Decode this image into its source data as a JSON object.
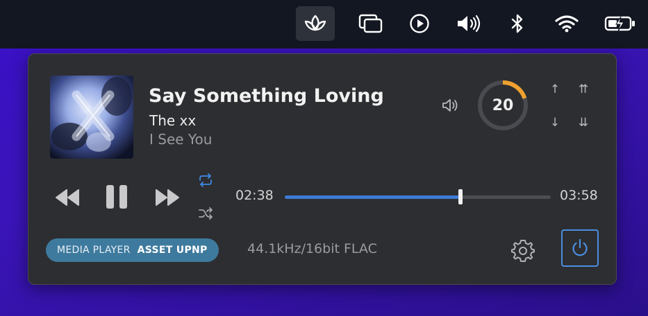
{
  "menubar": {
    "items": [
      {
        "icon": "lotus-icon",
        "active": true
      },
      {
        "icon": "windows-icon"
      },
      {
        "icon": "play-circle-icon"
      },
      {
        "icon": "speaker-icon"
      },
      {
        "icon": "bluetooth-icon"
      },
      {
        "icon": "wifi-icon"
      },
      {
        "icon": "battery-charging-icon"
      }
    ]
  },
  "player": {
    "title": "Say Something Loving",
    "artist": "The xx",
    "album": "I See You",
    "volume": "20",
    "volume_fraction": 0.2,
    "elapsed": "02:38",
    "duration": "03:58",
    "progress_fraction": 0.66,
    "source_label": "MEDIA PLAYER",
    "source_name": "ASSET UPNP",
    "format": "44.1kHz/16bit FLAC",
    "arrows": {
      "up": "↑",
      "down": "↓",
      "up_double": "⇈",
      "down_double": "⇊"
    },
    "colors": {
      "accent": "#3f7ad6",
      "volume_arc": "#f0a030",
      "badge": "#3e7a9e",
      "power": "#4a8fe0"
    }
  }
}
